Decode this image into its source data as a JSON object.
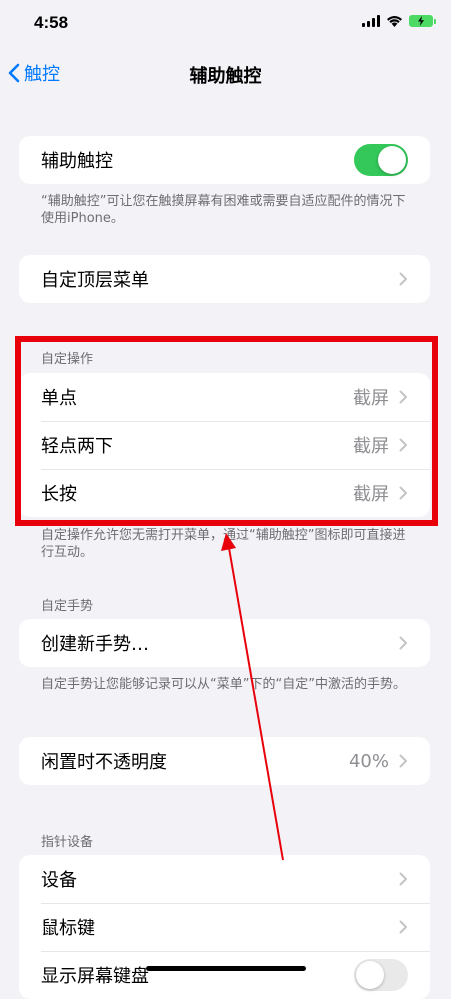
{
  "status_bar": {
    "time": "4:58"
  },
  "nav": {
    "back_label": "触控",
    "title": "辅助触控"
  },
  "assistive_touch": {
    "label": "辅助触控",
    "toggle_on": true,
    "note": "“辅助触控”可让您在触摸屏幕有困难或需要自适应配件的情况下使用iPhone。"
  },
  "top_menu": {
    "label": "自定顶层菜单"
  },
  "custom_actions": {
    "header": "自定操作",
    "items": [
      {
        "label": "单点",
        "value": "截屏"
      },
      {
        "label": "轻点两下",
        "value": "截屏"
      },
      {
        "label": "长按",
        "value": "截屏"
      }
    ],
    "note": "自定操作允许您无需打开菜单，通过“辅助触控”图标即可直接进行互动。"
  },
  "custom_gestures": {
    "header": "自定手势",
    "create_label": "创建新手势…",
    "note": "自定手势让您能够记录可以从“菜单”下的“自定”中激活的手势。"
  },
  "idle_opacity": {
    "label": "闲置时不透明度",
    "value": "40%"
  },
  "pointer_devices": {
    "header": "指针设备",
    "items": [
      {
        "label": "设备"
      },
      {
        "label": "鼠标键"
      },
      {
        "label": "显示屏幕键盘"
      }
    ]
  },
  "colors": {
    "accent": "#007aff",
    "toggle_on": "#34c759",
    "annotation": "#e8000b",
    "background": "#f2f2f7"
  }
}
